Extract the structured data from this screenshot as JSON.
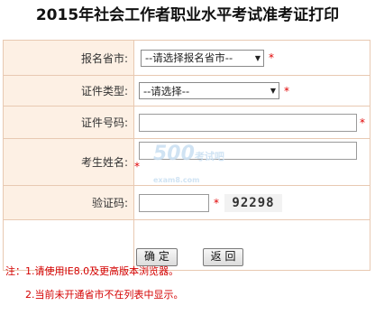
{
  "page": {
    "title": "2015年社会工作者职业水平考试准考证打印"
  },
  "form": {
    "province": {
      "label": "报名省市:",
      "selected": "--请选择报名省市--"
    },
    "id_type": {
      "label": "证件类型:",
      "selected": "--请选择--"
    },
    "id_number": {
      "label": "证件号码:",
      "value": ""
    },
    "name": {
      "label": "考生姓名:",
      "value": ""
    },
    "captcha": {
      "label": "验证码:",
      "value": "",
      "code": "92298"
    },
    "required_mark": "*"
  },
  "buttons": {
    "confirm": "确 定",
    "back": "返 回"
  },
  "notes": {
    "line1": "注：1.请使用IE8.0及更高版本浏览器。",
    "line2": "2.当前未开通省市不在列表中显示。"
  },
  "watermark": {
    "logo": "500",
    "text": "考试吧",
    "domain": "exam8.com"
  },
  "colors": {
    "label_bg": "#fdf0e4",
    "border": "#e8c9b2",
    "required": "#e00000",
    "note": "#d40000"
  }
}
